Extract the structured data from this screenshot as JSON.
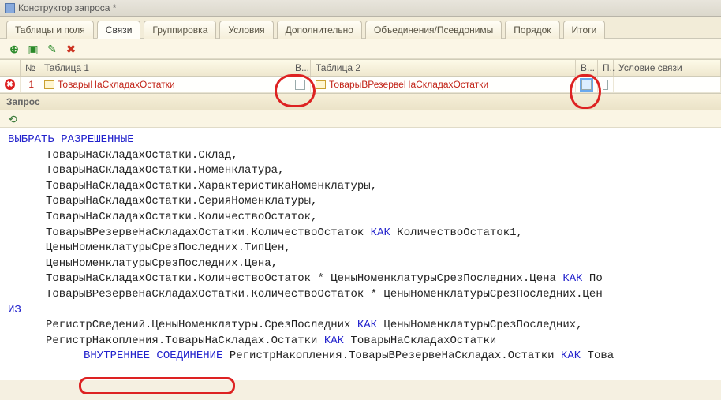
{
  "window": {
    "title": "Конструктор запроса *"
  },
  "tabs": [
    {
      "label": "Таблицы и поля"
    },
    {
      "label": "Связи"
    },
    {
      "label": "Группировка"
    },
    {
      "label": "Условия"
    },
    {
      "label": "Дополнительно"
    },
    {
      "label": "Объединения/Псевдонимы"
    },
    {
      "label": "Порядок"
    },
    {
      "label": "Итоги"
    }
  ],
  "active_tab_index": 1,
  "columns": {
    "no": "№",
    "table1": "Таблица 1",
    "v1": "В...",
    "table2": "Таблица 2",
    "v2": "В...",
    "p": "П..",
    "cond": "Условие связи"
  },
  "rows": [
    {
      "no": "1",
      "table1": "ТоварыНаСкладахОстатки",
      "v1_checked": false,
      "table2": "ТоварыВРезервеНаСкладахОстатки",
      "v2_checked": false,
      "v2_selected": true,
      "p_checked": false,
      "cond": ""
    }
  ],
  "section_label": "Запрос",
  "query": {
    "l1a": "ВЫБРАТЬ",
    "l1b": "РАЗРЕШЕННЫЕ",
    "l2": "ТоварыНаСкладахОстатки.Склад,",
    "l3": "ТоварыНаСкладахОстатки.Номенклатура,",
    "l4": "ТоварыНаСкладахОстатки.ХарактеристикаНоменклатуры,",
    "l5": "ТоварыНаСкладахОстатки.СерияНоменклатуры,",
    "l6": "ТоварыНаСкладахОстатки.КоличествоОстаток,",
    "l7a": "ТоварыВРезервеНаСкладахОстатки.КоличествоОстаток ",
    "l7k": "КАК",
    "l7b": " КоличествоОстаток1,",
    "l8": "ЦеныНоменклатурыСрезПоследних.ТипЦен,",
    "l9": "ЦеныНоменклатурыСрезПоследних.Цена,",
    "l10a": "ТоварыНаСкладахОстатки.КоличествоОстаток * ЦеныНоменклатурыСрезПоследних.Цена ",
    "l10k": "КАК",
    "l10b": " По",
    "l11": "ТоварыВРезервеНаСкладахОстатки.КоличествоОстаток * ЦеныНоменклатурыСрезПоследних.Цен",
    "l12": "ИЗ",
    "l13a": "РегистрСведений.ЦеныНоменклатуры.СрезПоследних ",
    "l13k": "КАК",
    "l13b": " ЦеныНоменклатурыСрезПоследних,",
    "l14a": "РегистрНакопления.ТоварыНаСкладах.Остатки ",
    "l14k": "КАК",
    "l14b": " ТоварыНаСкладахОстатки",
    "l15a": "ВНУТРЕННЕЕ",
    "l15b": "СОЕДИНЕНИЕ",
    "l15c": " РегистрНакопления.ТоварыВРезервеНаСкладах.Остатки ",
    "l15k": "КАК",
    "l15d": " Това"
  }
}
